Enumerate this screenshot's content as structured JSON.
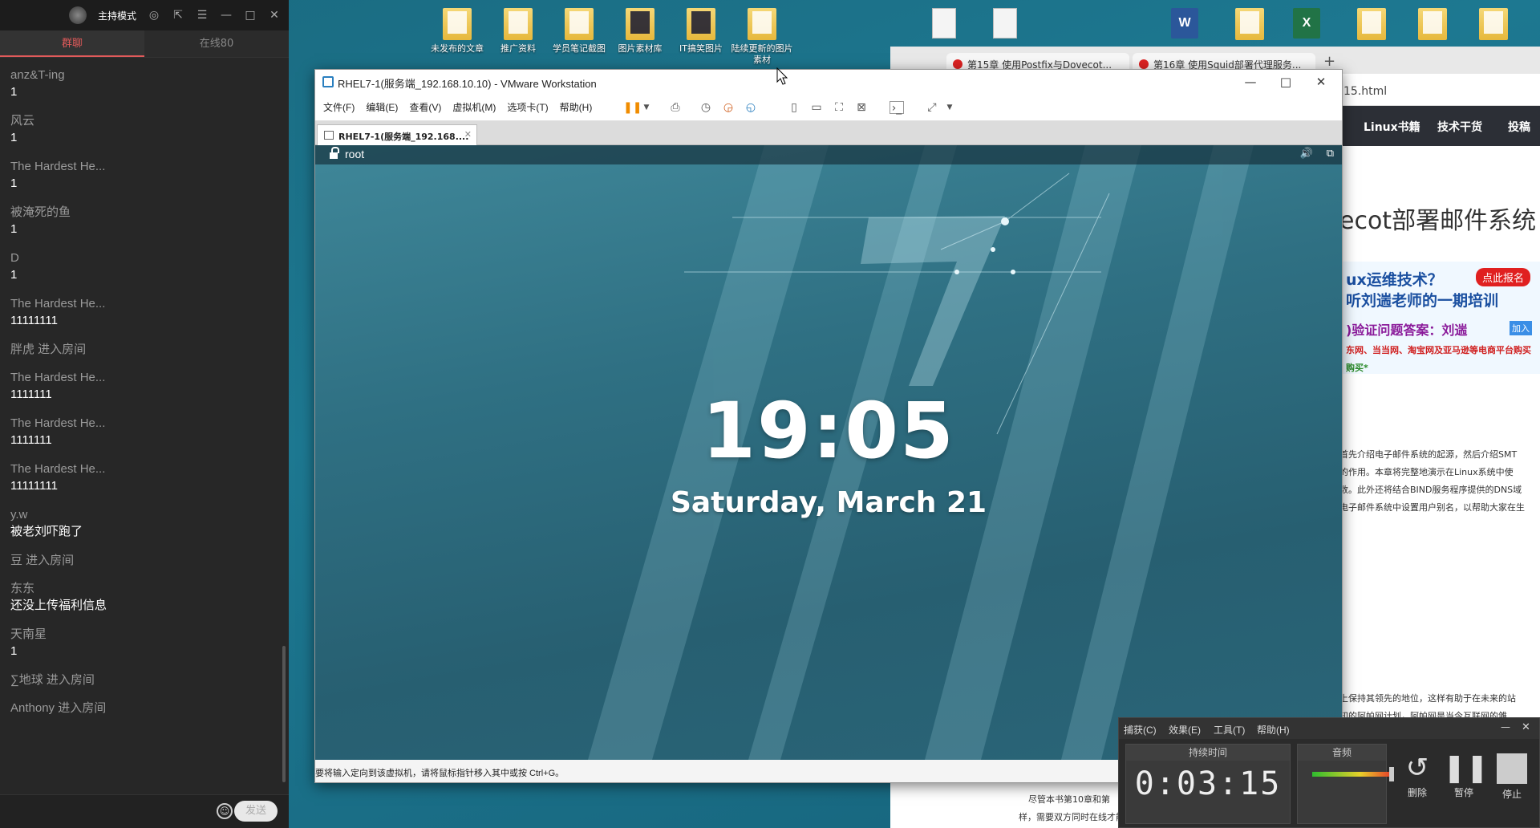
{
  "desktop": {
    "icons": [
      {
        "label": "未发布的文章",
        "kind": "folder"
      },
      {
        "label": "推广资料",
        "kind": "folder"
      },
      {
        "label": "学员笔记截图",
        "kind": "folder"
      },
      {
        "label": "图片素材库",
        "kind": "folder-dark"
      },
      {
        "label": "IT搞笑图片",
        "kind": "folder-dark"
      },
      {
        "label": "陆续更新的图片素材",
        "kind": "folder"
      }
    ]
  },
  "chat": {
    "mode_label": "主持模式",
    "tabs": [
      "群聊",
      "在线80"
    ],
    "messages": [
      {
        "name": "anz&T-ing",
        "text": "1"
      },
      {
        "name": "风云",
        "text": "1"
      },
      {
        "name": "The Hardest He...",
        "text": "1"
      },
      {
        "name": "被淹死的鱼",
        "text": "1"
      },
      {
        "name": "D",
        "text": "1"
      },
      {
        "name": "The Hardest He...",
        "text": "11111111"
      },
      {
        "name": "胖虎 进入房间",
        "text": ""
      },
      {
        "name": "The Hardest He...",
        "text": "1111111"
      },
      {
        "name": "The Hardest He...",
        "text": "1111111"
      },
      {
        "name": "The Hardest He...",
        "text": "11111111"
      },
      {
        "name": "y.w",
        "text": "被老刘吓跑了"
      },
      {
        "name": "豆 进入房间",
        "text": ""
      },
      {
        "name": "东东",
        "text": "还没上传福利信息"
      },
      {
        "name": "天南星",
        "text": "1"
      },
      {
        "name": "∑地球 进入房间",
        "text": ""
      },
      {
        "name": "Anthony 进入房间",
        "text": ""
      }
    ],
    "send_label": "发送"
  },
  "browser": {
    "tabs": [
      "第15章 使用Postfix与Dovecot...",
      "第16章 使用Squid部署代理服务..."
    ],
    "new_tab": "+",
    "url_fragment": "15.html",
    "nav": [
      "Linux书籍",
      "技术干货",
      "投稿"
    ],
    "title_fragment": "ecot部署邮件系统",
    "ad": {
      "line1": "ux运维技术？",
      "badge": "点此报名",
      "line2": "听刘遄老师的一期培训",
      "line3": ")验证问题答案：刘遄",
      "join": "加入",
      "line4": "东网、当当网、淘宝网及亚马逊等电商平台购买",
      "line5": "购买*"
    },
    "body_lines": [
      "首先介绍电子邮件系统的起源，然后介绍SMT",
      "的作用。本章将完整地演示在Linux系统中使",
      "数。此外还将结合BIND服务程序提供的DNS域",
      "电子邮件系统中设置用户别名，以帮助大家在生"
    ],
    "bottom_lines": [
      "上保持其领先的地位，这样有助于在未来的站",
      "知的阿帕网计划，阿帕网是当今互联网的雏",
      "尽管本书第10章和第",
      "样，需要双方同时在线才能完成传输工作，如果对方的主机宕机或者研发员由"
    ]
  },
  "vmware": {
    "title": "RHEL7-1(服务端_192.168.10.10) - VMware Workstation",
    "menu": [
      "文件(F)",
      "编辑(E)",
      "查看(V)",
      "虚拟机(M)",
      "选项卡(T)",
      "帮助(H)"
    ],
    "tab_label": "RHEL7-1(服务端_192.168....",
    "statusbar": "要将输入定向到该虚拟机，请将鼠标指针移入其中或按 Ctrl+G。"
  },
  "vm": {
    "user": "root",
    "time": "19:05",
    "date": "Saturday, March 21"
  },
  "recorder": {
    "menu": [
      "捕获(C)",
      "效果(E)",
      "工具(T)",
      "帮助(H)"
    ],
    "duration_label": "持续时间",
    "duration": "0:03:15",
    "audio_label": "音频",
    "delete_label": "删除",
    "pause_label": "暂停",
    "stop_label": "停止"
  }
}
